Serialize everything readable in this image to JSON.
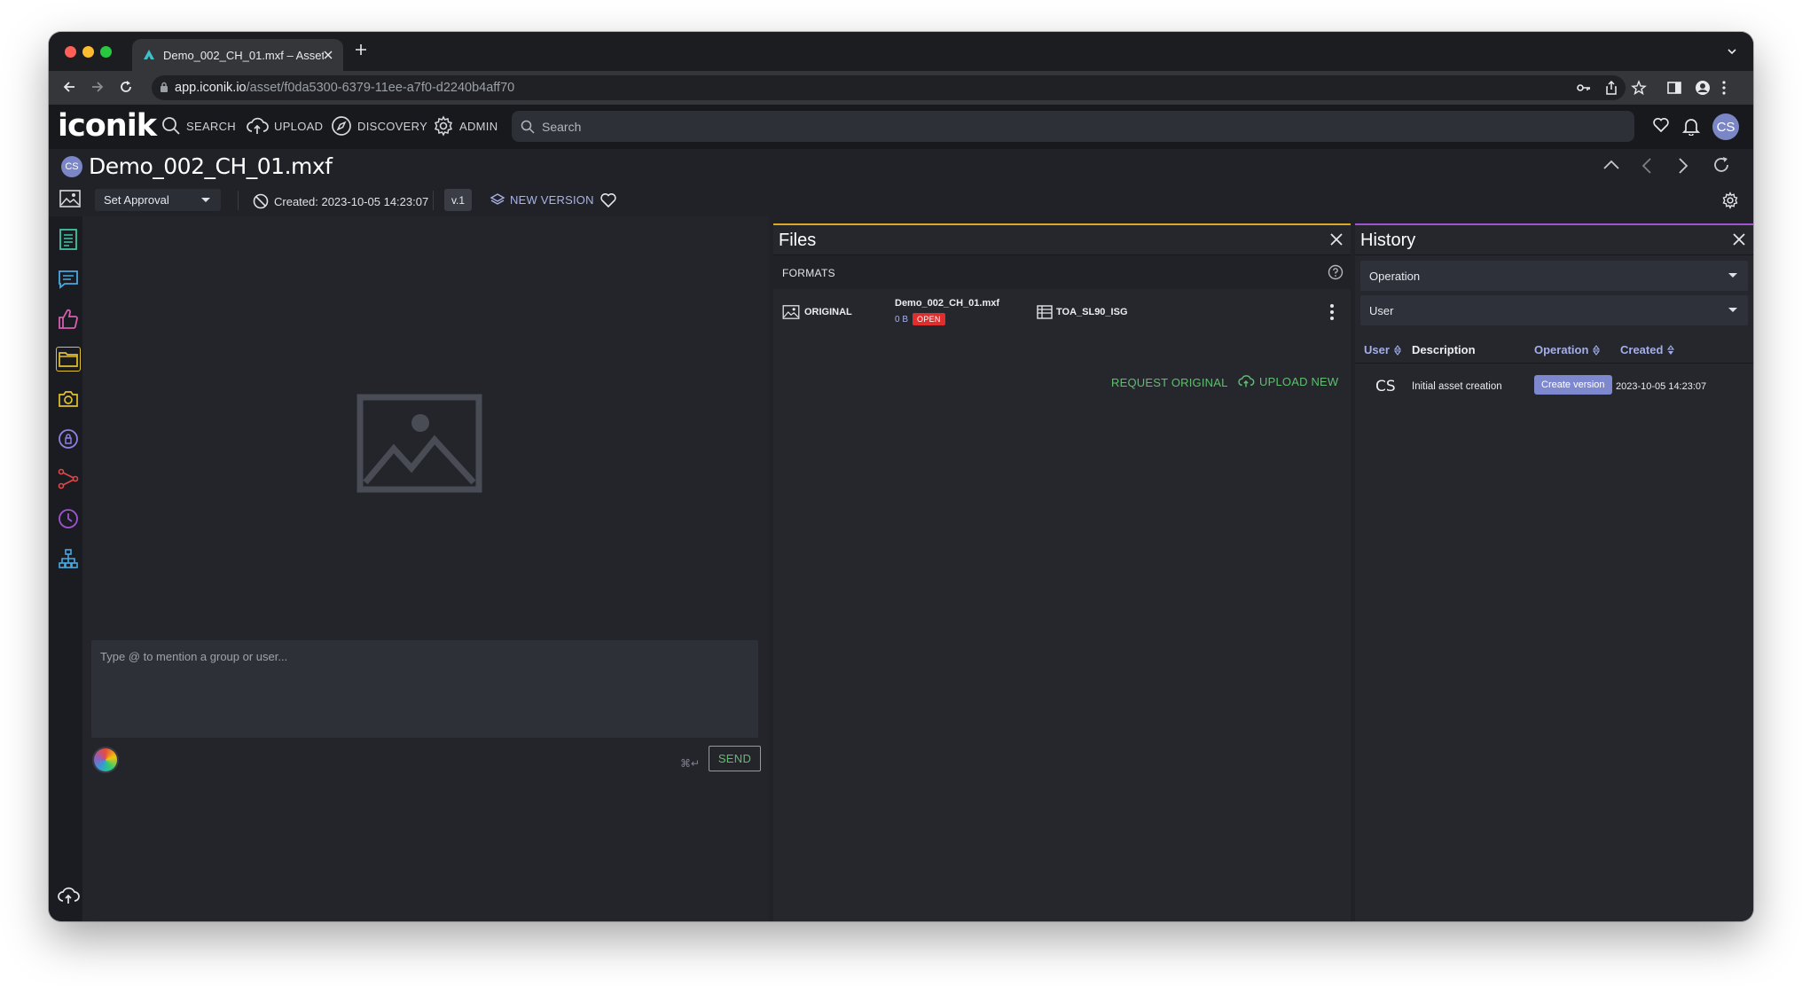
{
  "browser": {
    "tab_title": "Demo_002_CH_01.mxf – Asset",
    "url_host": "app.iconik.io",
    "url_path": "/asset/f0da5300-6379-11ee-a7f0-d2240b4aff70"
  },
  "app": {
    "logo": "iconik",
    "nav": {
      "search": "SEARCH",
      "upload": "UPLOAD",
      "discovery": "DISCOVERY",
      "admin": "ADMIN"
    },
    "search_placeholder": "Search",
    "user_initials": "CS"
  },
  "asset": {
    "owner_initials": "CS",
    "title": "Demo_002_CH_01.mxf",
    "approval_label": "Set Approval",
    "created": "Created: 2023-10-05 14:23:07",
    "version": "v.1",
    "new_version": "NEW VERSION"
  },
  "comment": {
    "placeholder": "Type @ to mention a group or user...",
    "shortcut": "⌘↵",
    "send": "SEND"
  },
  "files": {
    "title": "Files",
    "formats_label": "FORMATS",
    "format_name": "ORIGINAL",
    "file_name": "Demo_002_CH_01.mxf",
    "file_size": "0 B",
    "status": "OPEN",
    "storage": "TOA_SL90_ISG",
    "request_original": "REQUEST ORIGINAL",
    "upload_new": "UPLOAD NEW"
  },
  "history": {
    "title": "History",
    "filter_operation": "Operation",
    "filter_user": "User",
    "columns": {
      "user": "User",
      "description": "Description",
      "operation": "Operation",
      "created": "Created"
    },
    "rows": [
      {
        "user": "CS",
        "description": "Initial asset creation",
        "operation": "Create version",
        "created": "2023-10-05 14:23:07"
      }
    ]
  },
  "colors": {
    "files_accent": "#d8a928",
    "history_accent": "#a054d4",
    "action_green": "#5fbf6f",
    "open_badge": "#e02d2d",
    "operation_badge": "#7d88cf"
  }
}
